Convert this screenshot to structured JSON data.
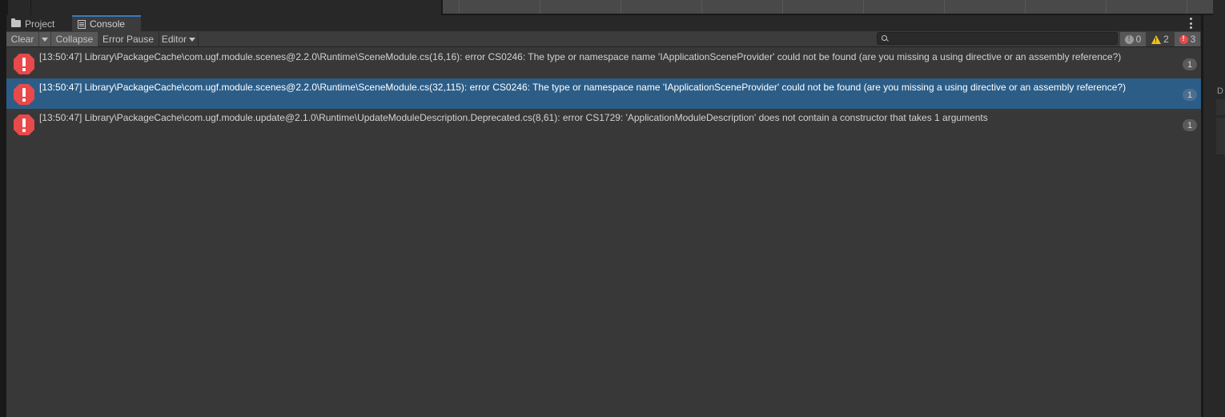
{
  "tabs": [
    {
      "label": "Project",
      "icon": "folder-icon",
      "active": false
    },
    {
      "label": "Console",
      "icon": "console-icon",
      "active": true
    }
  ],
  "toolbar": {
    "clear_label": "Clear",
    "collapse_label": "Collapse",
    "error_pause_label": "Error Pause",
    "editor_label": "Editor",
    "search_placeholder": "",
    "search_value": ""
  },
  "counters": {
    "info": "0",
    "warnings": "2",
    "errors": "3"
  },
  "logs": [
    {
      "type": "error",
      "message": "[13:50:47] Library\\PackageCache\\com.ugf.module.scenes@2.2.0\\Runtime\\SceneModule.cs(16,16): error CS0246: The type or namespace name 'IApplicationSceneProvider' could not be found (are you missing a using directive or an assembly reference?)",
      "count": "1",
      "selected": false
    },
    {
      "type": "error",
      "message": "[13:50:47] Library\\PackageCache\\com.ugf.module.scenes@2.2.0\\Runtime\\SceneModule.cs(32,115): error CS0246: The type or namespace name 'IApplicationSceneProvider' could not be found (are you missing a using directive or an assembly reference?)",
      "count": "1",
      "selected": true
    },
    {
      "type": "error",
      "message": "[13:50:47] Library\\PackageCache\\com.ugf.module.update@2.1.0\\Runtime\\UpdateModuleDescription.Deprecated.cs(8,61): error CS1729: 'ApplicationModuleDescription' does not contain a constructor that takes 1 arguments",
      "count": "1",
      "selected": false
    }
  ],
  "right_panel": {
    "label": "D"
  },
  "colors": {
    "selection": "#2c5d87",
    "error": "#e8494a",
    "warning": "#f0c21c",
    "active_tab_accent": "#3a79bb"
  }
}
